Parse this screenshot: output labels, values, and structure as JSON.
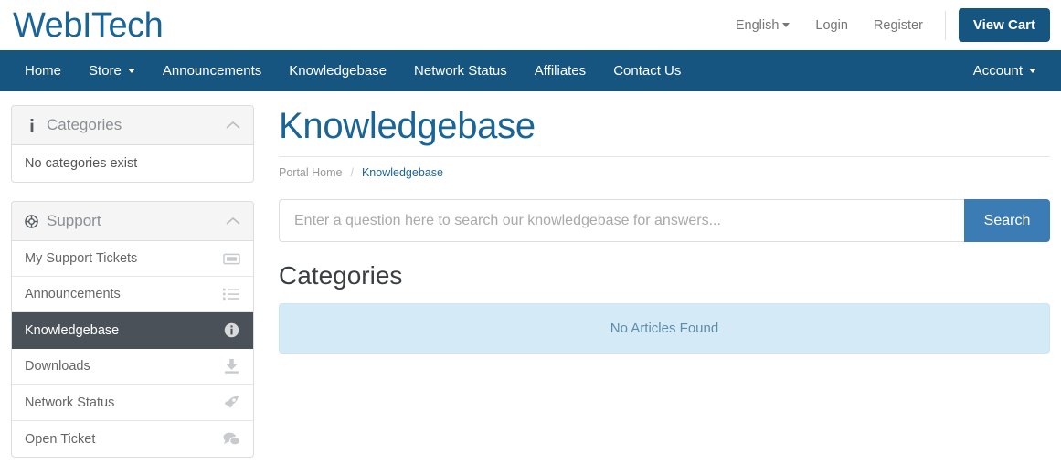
{
  "header": {
    "logo": "WebITech",
    "language": {
      "label": "English",
      "icon": "caret-down-icon"
    },
    "login": "Login",
    "register": "Register",
    "view_cart": "View Cart",
    "accent_color": "#15557f",
    "logo_color": "#1a6496"
  },
  "navbar": {
    "background_color": "#15557f",
    "left_items": [
      {
        "label": "Home",
        "caret": false
      },
      {
        "label": "Store",
        "caret": true
      },
      {
        "label": "Announcements",
        "caret": false
      },
      {
        "label": "Knowledgebase",
        "caret": false
      },
      {
        "label": "Network Status",
        "caret": false
      },
      {
        "label": "Affiliates",
        "caret": false
      },
      {
        "label": "Contact Us",
        "caret": false
      }
    ],
    "right_items": [
      {
        "label": "Account",
        "caret": true
      }
    ]
  },
  "sidebar": {
    "categories_panel": {
      "title": "Categories",
      "icon": "info-icon",
      "collapse_icon": "chevron-up-icon",
      "body_text": "No categories exist"
    },
    "support_panel": {
      "title": "Support",
      "icon": "lifebuoy-icon",
      "collapse_icon": "chevron-up-icon",
      "items": [
        {
          "label": "My Support Tickets",
          "icon": "ticket-icon",
          "active": false
        },
        {
          "label": "Announcements",
          "icon": "list-ul-icon",
          "active": false
        },
        {
          "label": "Knowledgebase",
          "icon": "info-circle-icon",
          "active": true
        },
        {
          "label": "Downloads",
          "icon": "download-icon",
          "active": false
        },
        {
          "label": "Network Status",
          "icon": "rocket-icon",
          "active": false
        },
        {
          "label": "Open Ticket",
          "icon": "comments-icon",
          "active": false
        }
      ],
      "active_background": "#4a5158"
    }
  },
  "main": {
    "page_title": "Knowledgebase",
    "breadcrumb": {
      "home": "Portal Home",
      "separator": "/",
      "current": "Knowledgebase"
    },
    "search": {
      "placeholder": "Enter a question here to search our knowledgebase for answers...",
      "value": "",
      "button_label": "Search",
      "button_color": "#3c7cb5"
    },
    "categories_section": {
      "title": "Categories",
      "empty_message": "No Articles Found",
      "empty_background": "#d4ebf7",
      "empty_text_color": "#5e8ca8"
    }
  }
}
